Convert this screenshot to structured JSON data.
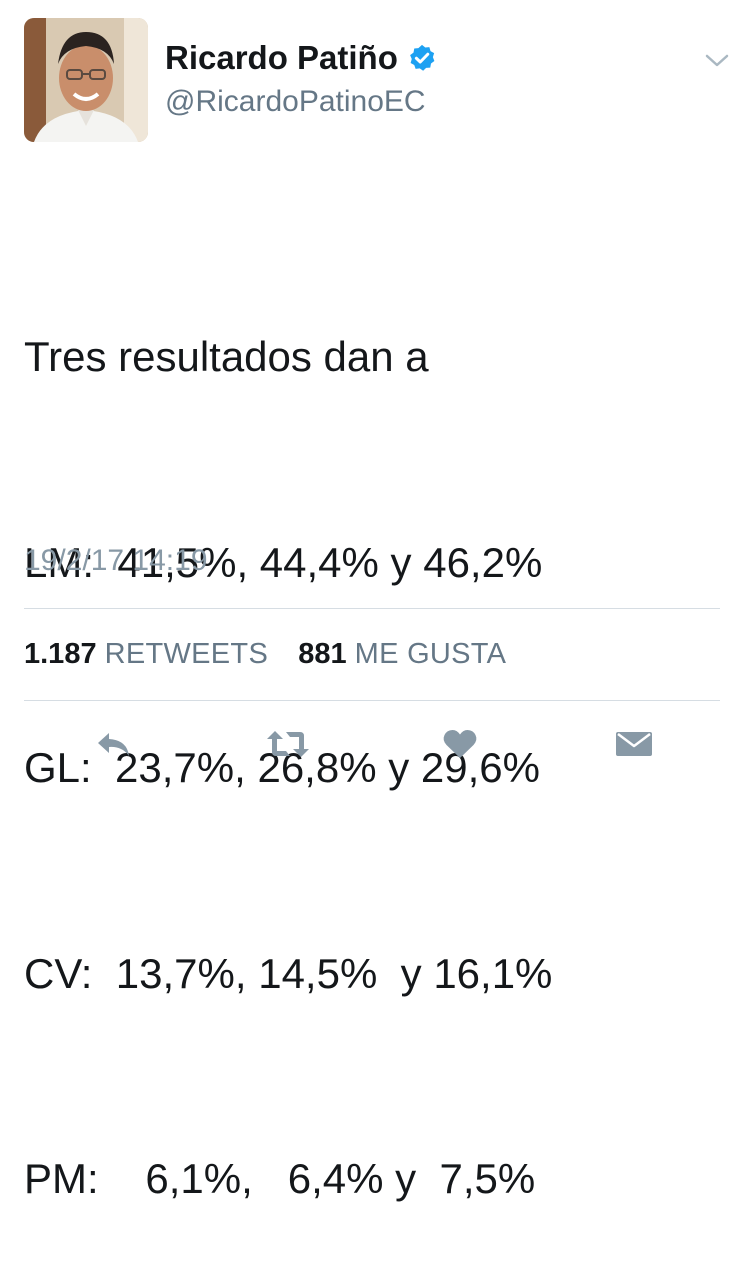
{
  "author": {
    "display_name": "Ricardo Patiño",
    "handle": "@RicardoPatinoEC",
    "verified": true,
    "avatar": "profile-photo"
  },
  "tweet": {
    "lines": [
      "Tres resultados dan a",
      "LM:  41,5%, 44,4% y 46,2%",
      "GL:  23,7%, 26,8% y 29,6%",
      "CV:  13,7%, 14,5%  y 16,1%",
      "PM:    6,1%,   6,4% y  7,5%"
    ],
    "timestamp": "19/2/17 14:19"
  },
  "stats": {
    "retweets_count": "1.187",
    "retweets_label": "RETWEETS",
    "likes_count": "881",
    "likes_label": "ME GUSTA"
  },
  "actions": {
    "reply_icon": "reply-icon",
    "retweet_icon": "retweet-icon",
    "like_icon": "heart-icon",
    "dm_icon": "envelope-icon"
  },
  "colors": {
    "verified_blue": "#1da1f2",
    "text_primary": "#14171a",
    "text_secondary": "#657786",
    "timestamp": "#8899a6",
    "action_icon": "#8899a6",
    "divider": "#d6dde3"
  }
}
